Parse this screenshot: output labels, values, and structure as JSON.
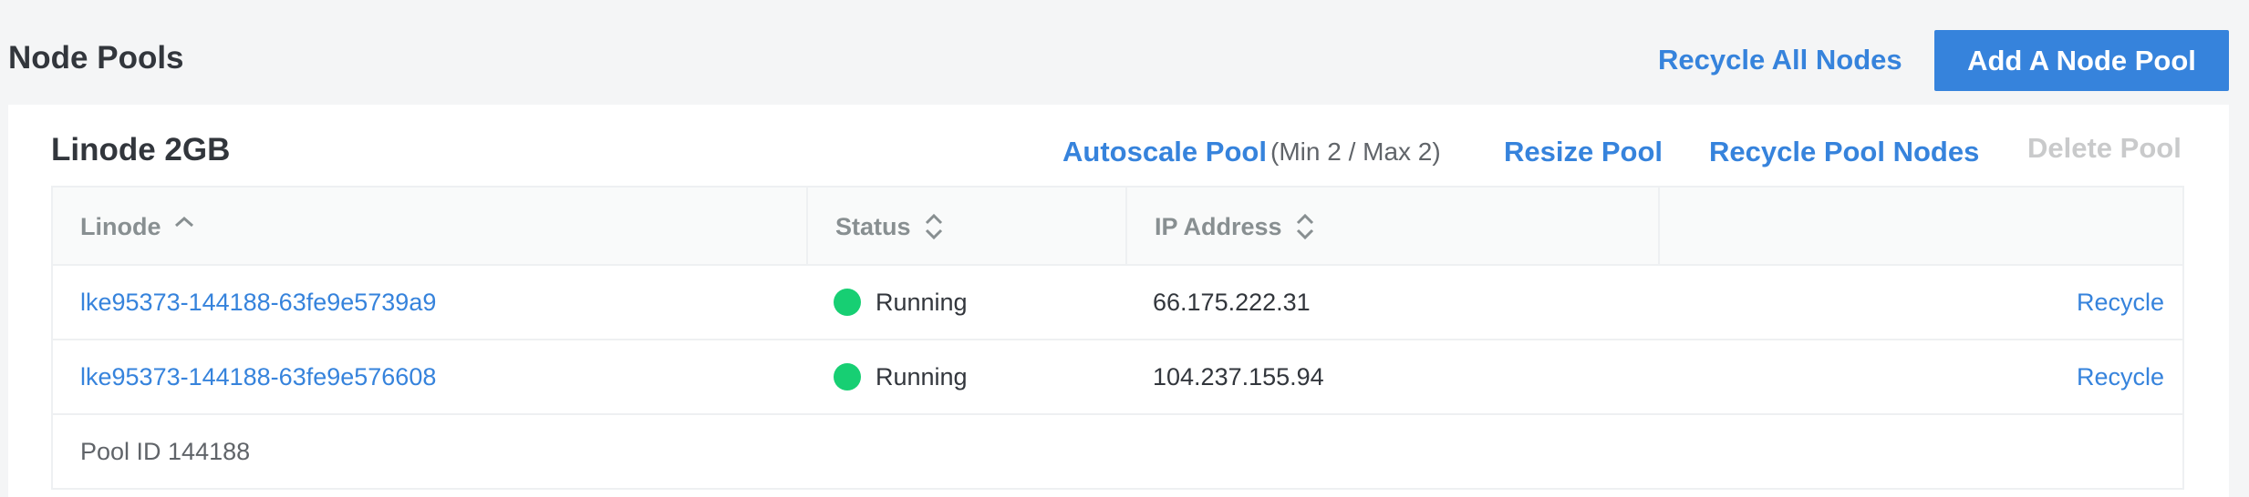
{
  "header": {
    "title": "Node Pools",
    "recycle_all_label": "Recycle All Nodes",
    "add_pool_label": "Add A Node Pool"
  },
  "pool": {
    "title": "Linode 2GB",
    "actions": {
      "autoscale_label": "Autoscale Pool",
      "autoscale_range": "(Min 2 / Max 2)",
      "resize_label": "Resize Pool",
      "recycle_nodes_label": "Recycle Pool Nodes",
      "delete_label": "Delete Pool"
    },
    "table": {
      "columns": [
        "Linode",
        "Status",
        "IP Address"
      ],
      "rows": [
        {
          "linode": "lke95373-144188-63fe9e5739a9",
          "status": "Running",
          "ip": "66.175.222.31",
          "action": "Recycle"
        },
        {
          "linode": "lke95373-144188-63fe9e576608",
          "status": "Running",
          "ip": "104.237.155.94",
          "action": "Recycle"
        }
      ],
      "footer": "Pool ID 144188"
    }
  },
  "colors": {
    "accent": "#3683dc",
    "status_running": "#17cf73",
    "disabled": "#c9cacb",
    "page_background": "#f4f5f6"
  },
  "icons": {
    "sort_ascending": "chevron-up-icon",
    "sortable": "sort-icon"
  }
}
